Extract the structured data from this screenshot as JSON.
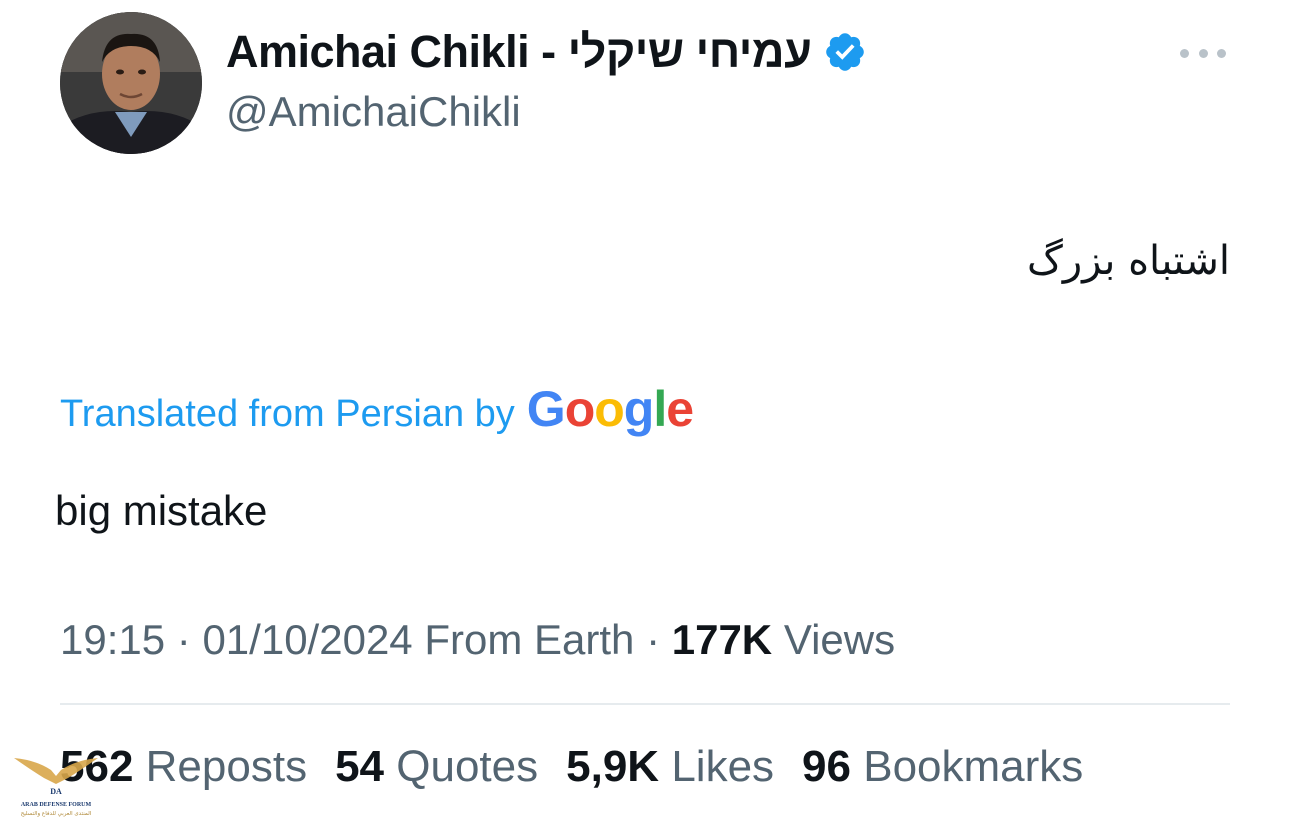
{
  "author": {
    "display_name": "Amichai Chikli - עמיחי שיקלי",
    "handle": "@AmichaiChikli",
    "verified_icon": "verified-badge-icon",
    "avatar": "profile-photo"
  },
  "tweet": {
    "original_text": "اشتباه بزرگ",
    "translation_label": "Translated from Persian by",
    "translation_provider": "Google",
    "translated_text": "big mistake"
  },
  "meta": {
    "time": "19:15",
    "separator": "·",
    "date": "01/10/2024",
    "source": "From Earth",
    "views_count": "177K",
    "views_label": "Views"
  },
  "stats": [
    {
      "count": "562",
      "label": "Reposts"
    },
    {
      "count": "54",
      "label": "Quotes"
    },
    {
      "count": "5,9K",
      "label": "Likes"
    },
    {
      "count": "96",
      "label": "Bookmarks"
    }
  ],
  "watermark": {
    "title": "ARAB DEFENSE FORUM",
    "subtitle": "المنتدى العربي للدفاع والتسليح"
  },
  "colors": {
    "accent": "#1d9bf0",
    "secondary_text": "#536471",
    "primary_text": "#0f1419"
  }
}
